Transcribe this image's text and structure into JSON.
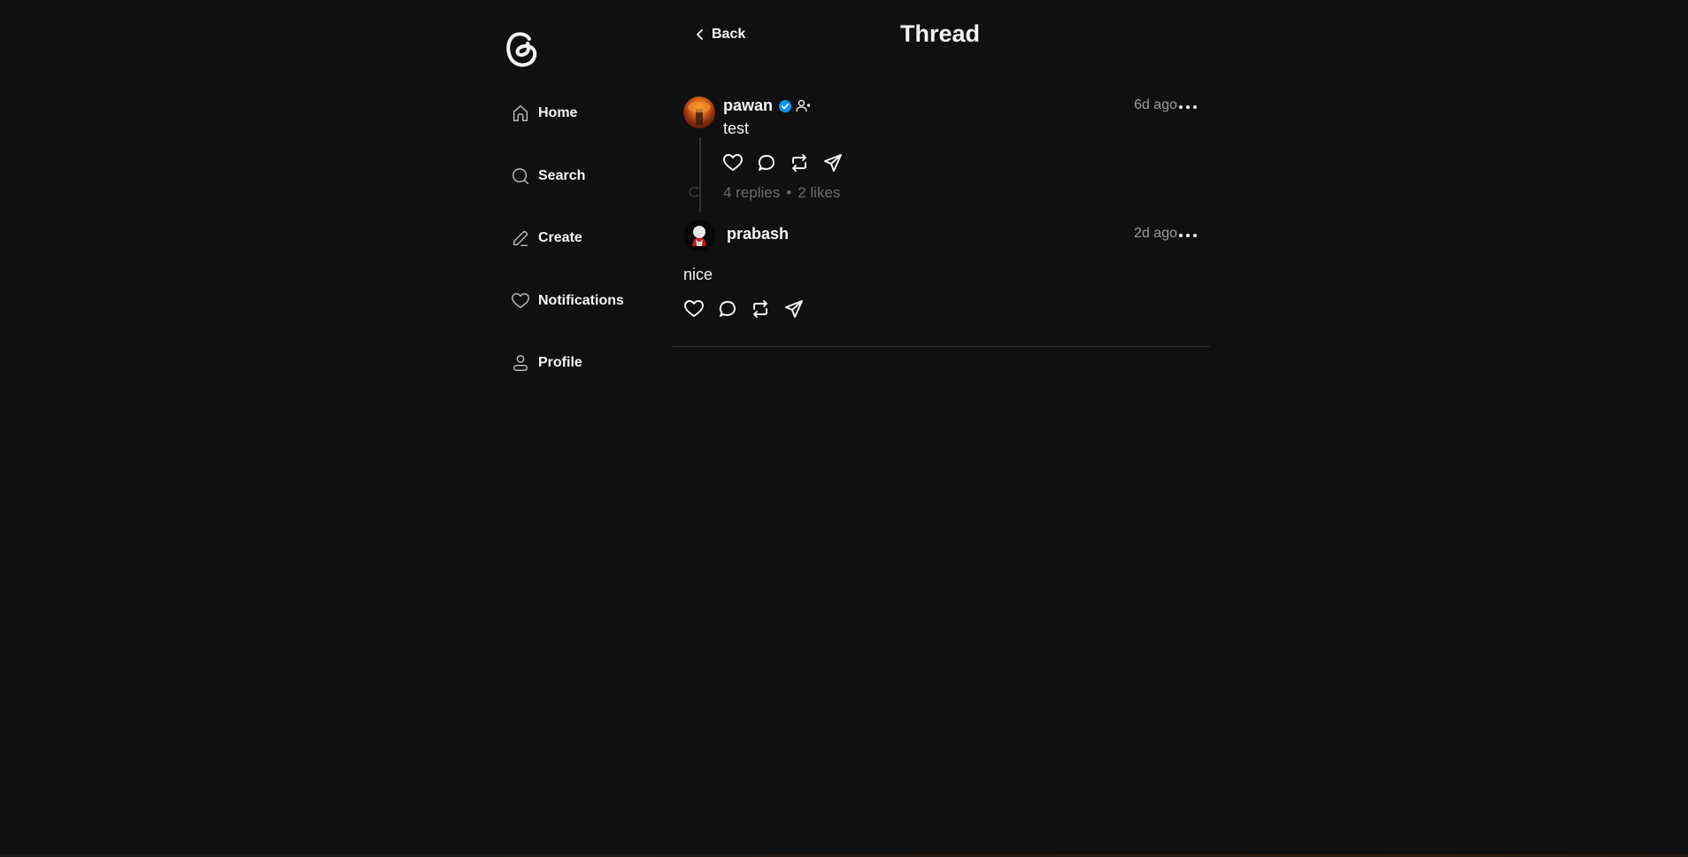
{
  "app": {
    "logo": "threads-logo"
  },
  "sidebar": {
    "items": [
      {
        "label": "Home",
        "icon": "home-icon"
      },
      {
        "label": "Search",
        "icon": "search-icon"
      },
      {
        "label": "Create",
        "icon": "edit-icon"
      },
      {
        "label": "Notifications",
        "icon": "heart-icon"
      },
      {
        "label": "Profile",
        "icon": "user-icon"
      }
    ]
  },
  "header": {
    "back_label": "Back",
    "title": "Thread"
  },
  "thread": {
    "main_post": {
      "username": "pawan",
      "verified": true,
      "time": "6d ago",
      "text": "test",
      "stats": {
        "replies": "4 replies",
        "separator": "•",
        "likes": "2 likes"
      }
    },
    "replies": [
      {
        "username": "prabash",
        "time": "2d ago",
        "text": "nice"
      }
    ]
  },
  "colors": {
    "background": "#101010",
    "text": "#f3f5f7",
    "muted": "#9a9a9a",
    "verified": "#0095f6"
  }
}
